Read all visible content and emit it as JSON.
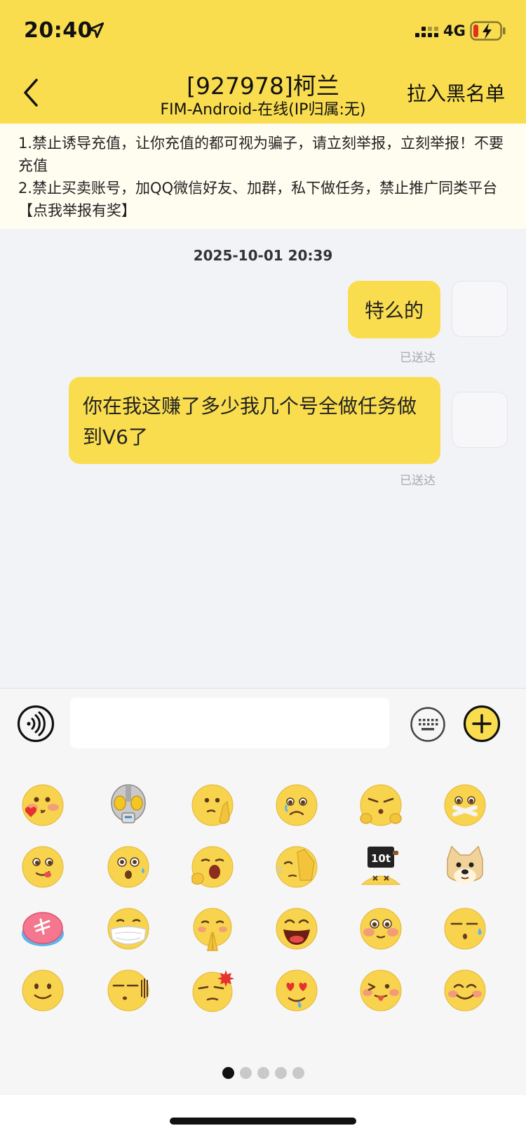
{
  "status_bar": {
    "time": "20:40",
    "network": "4G"
  },
  "header": {
    "title": "[927978]柯兰",
    "subtitle": "FIM-Android-在线(IP归属:无)",
    "action_label": "拉入黑名单"
  },
  "notice": {
    "lines": [
      "1.禁止诱导充值，让你充值的都可视为骗子，请立刻举报，立刻举报！不要充值",
      "2.禁止买卖账号，加QQ微信好友、加群，私下做任务，禁止推广同类平台【点我举报有奖】"
    ]
  },
  "chat": {
    "timestamp": "2025-10-01 20:39",
    "messages": [
      {
        "text": "特么的",
        "receipt": "已送达"
      },
      {
        "text": "你在我这赚了多少我几个号全做任务做到V6了",
        "receipt": "已送达"
      }
    ]
  },
  "input": {
    "placeholder": ""
  },
  "emoji_panel": {
    "pages": 5,
    "current_page": 1,
    "icons": [
      "blush-kiss-emoji",
      "ultraman-emoji",
      "thinking-emoji",
      "sad-emoji",
      "huff-emoji",
      "sealed-lips-emoji",
      "yum-emoji",
      "surprised-sweat-emoji",
      "yawn-emoji",
      "facepalm-emoji",
      "10t-weight-emoji",
      "doge-emoji",
      "red-packet-emoji",
      "mask-emoji",
      "pray-emoji",
      "laugh-emoji",
      "shy-emoji",
      "speechless-sweat-emoji",
      "smile-emoji",
      "deadpan-emoji",
      "annoyed-emoji",
      "heart-eyes-emoji",
      "tongue-emoji",
      "happy-emoji"
    ]
  },
  "colors": {
    "accent": "#f9dd4f",
    "notice_bg": "#fffdf0",
    "chat_bg": "#f2f3f7"
  }
}
